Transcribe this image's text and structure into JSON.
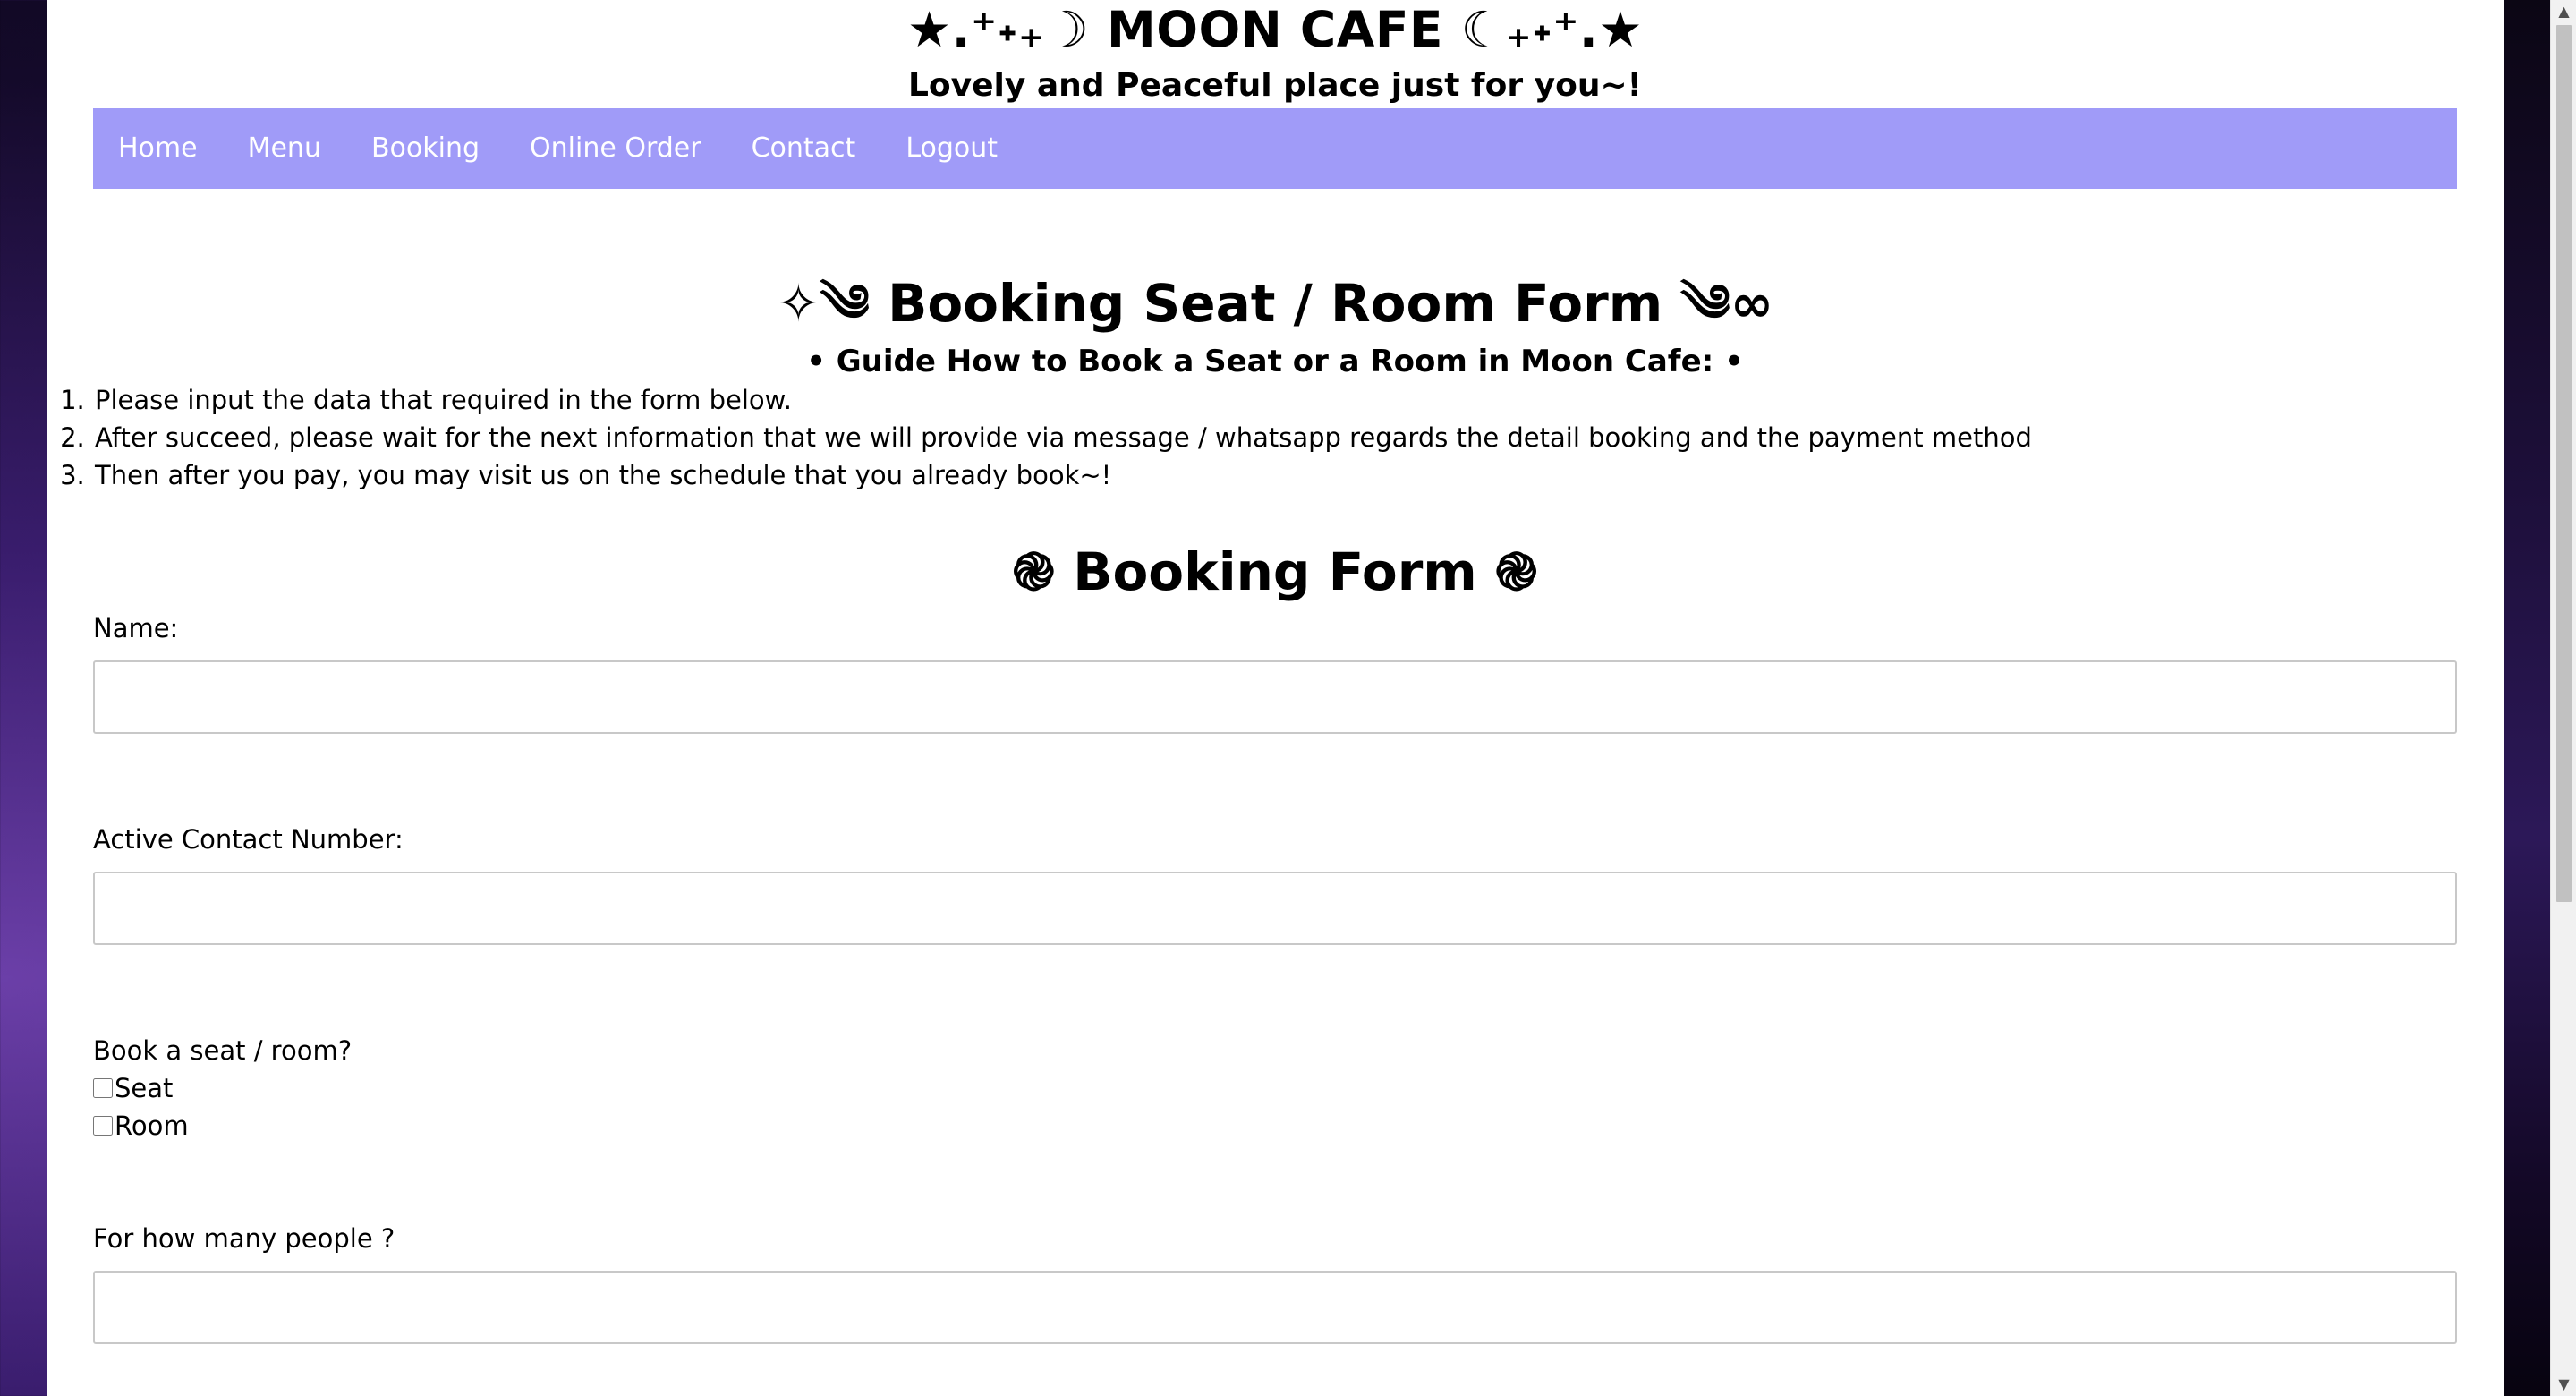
{
  "header": {
    "title": "★.⁺˖₊☽ MOON CAFE ☾₊˖⁺.★",
    "tagline": "Lovely and Peaceful place just for you~!"
  },
  "nav": {
    "items": [
      "Home",
      "Menu",
      "Booking",
      "Online Order",
      "Contact",
      "Logout"
    ],
    "background": "#a09bf8"
  },
  "booking": {
    "title": "✧༄ Booking Seat / Room Form ༄∞",
    "guide_title": "• Guide How to Book a Seat or a Room in Moon Cafe: •",
    "guide_steps": [
      "Please input the data that required in the form below.",
      "After succeed, please wait for the next information that we will provide via message / whatsapp regards the detail booking and the payment method",
      "Then after you pay, you may visit us on the schedule that you already book~!"
    ]
  },
  "form": {
    "title": "֎ Booking Form ֎",
    "name_label": "Name:",
    "name_value": "",
    "contact_label": "Active Contact Number:",
    "contact_value": "",
    "book_type_label": "Book a seat / room?",
    "options": [
      "Seat",
      "Room"
    ],
    "people_label": "For how many people ?",
    "people_value": ""
  },
  "scrollbar": {
    "up_icon": "triangle-up",
    "down_icon": "triangle-down"
  }
}
